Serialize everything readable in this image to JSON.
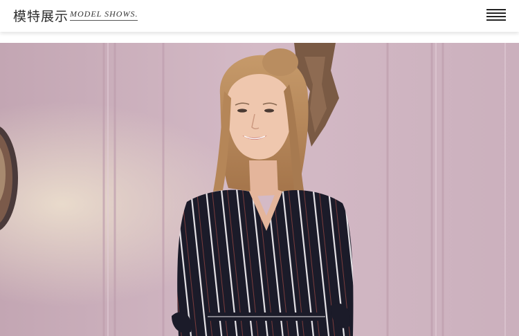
{
  "header": {
    "title_cn": "模特展示",
    "title_en": "MODEL SHOWS.",
    "menu_icon": "hamburger-menu-icon"
  },
  "photo": {
    "subject": "model-photo"
  },
  "colors": {
    "header_bg": "#ffffff",
    "text": "#2b2b2b",
    "wall": "#cdb0bd",
    "dress": "#1c1c2a"
  }
}
